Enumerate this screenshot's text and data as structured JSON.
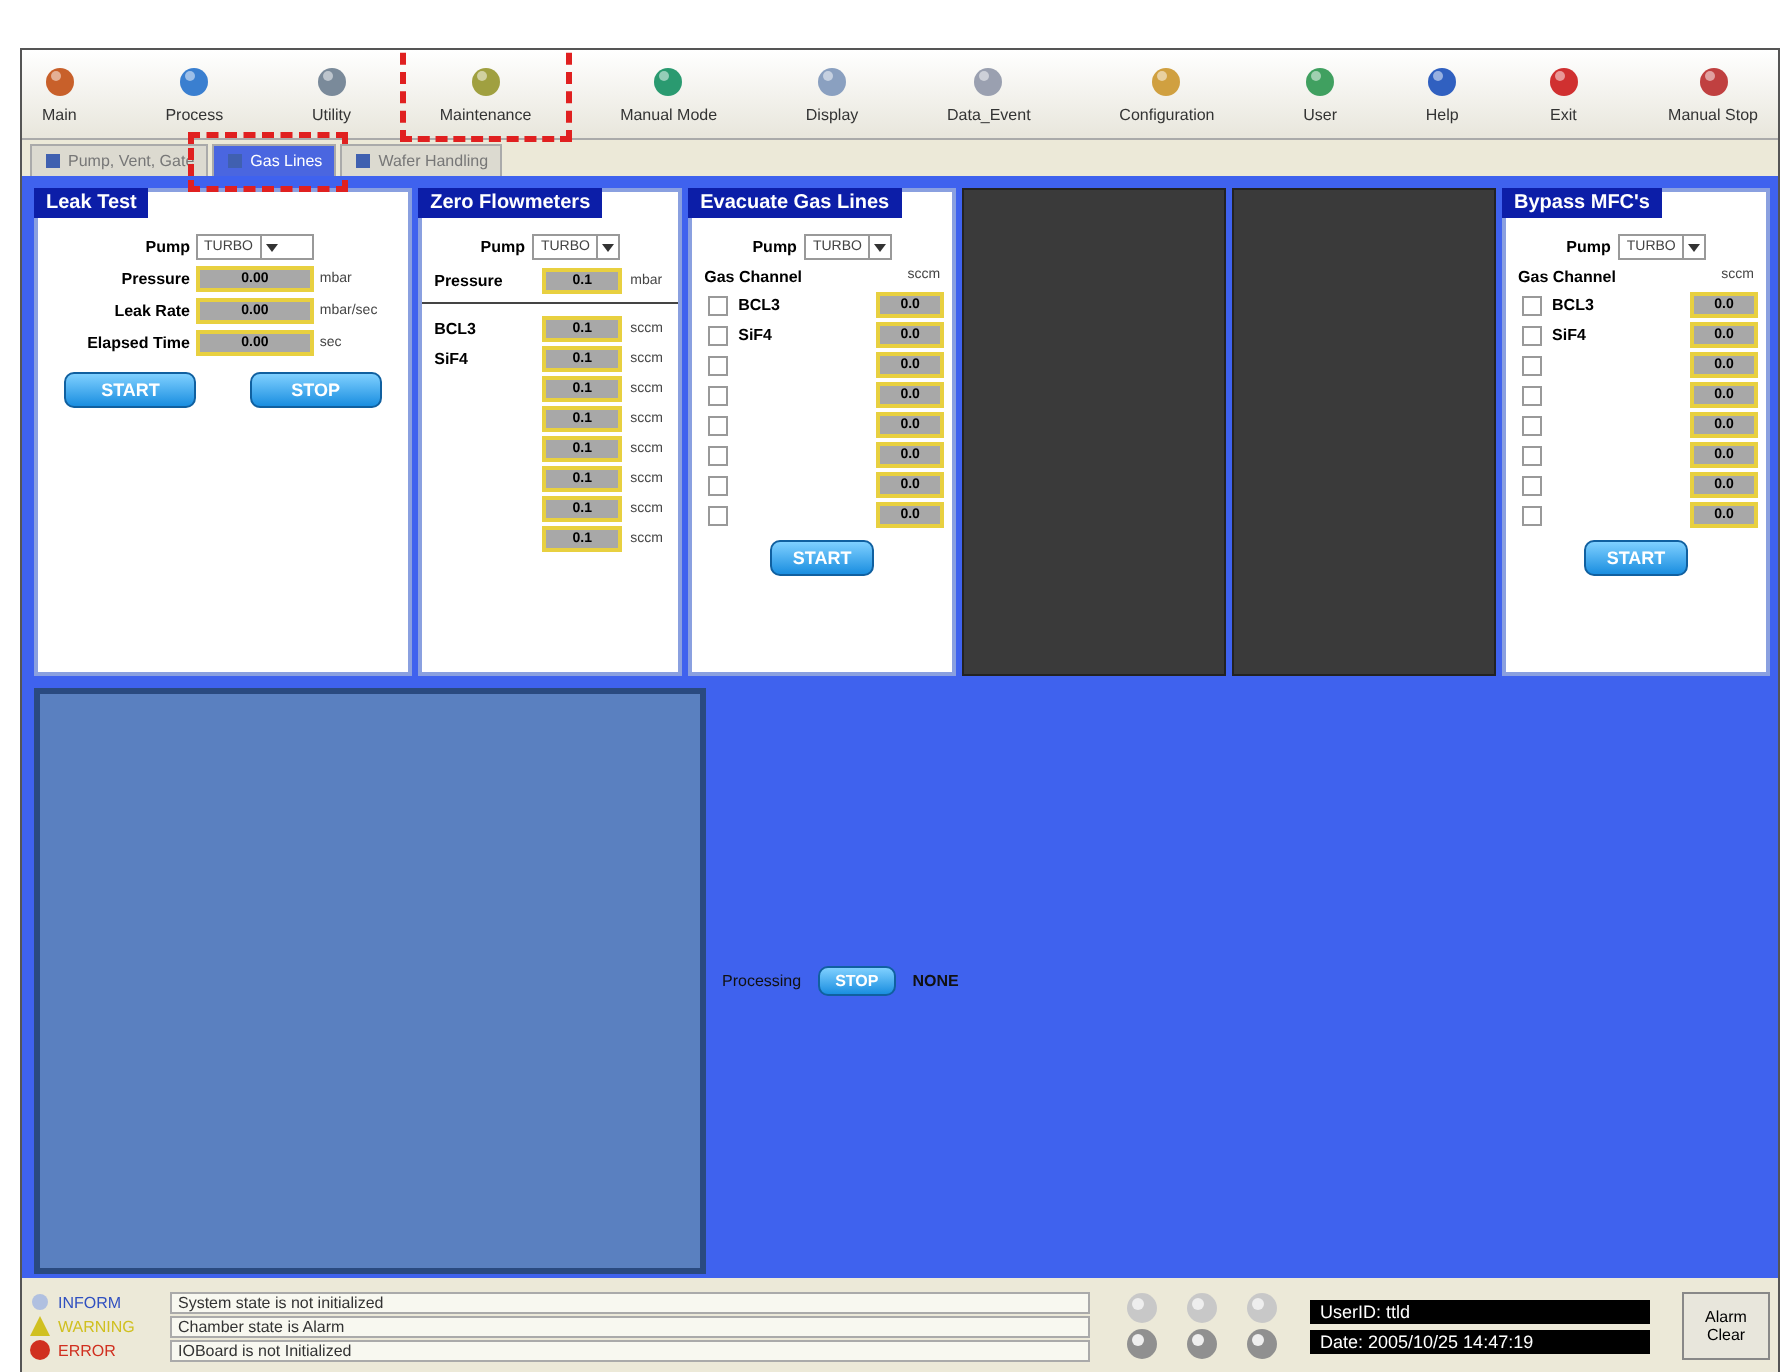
{
  "toolbar": [
    {
      "label": "Main",
      "highlighted": false
    },
    {
      "label": "Process",
      "highlighted": false
    },
    {
      "label": "Utility",
      "highlighted": false
    },
    {
      "label": "Maintenance",
      "highlighted": true
    },
    {
      "label": "Manual Mode",
      "highlighted": false
    },
    {
      "label": "Display",
      "highlighted": false
    },
    {
      "label": "Data_Event",
      "highlighted": false
    },
    {
      "label": "Configuration",
      "highlighted": false
    },
    {
      "label": "User",
      "highlighted": false
    },
    {
      "label": "Help",
      "highlighted": false
    },
    {
      "label": "Exit",
      "highlighted": false
    },
    {
      "label": "Manual Stop",
      "highlighted": false
    }
  ],
  "tabs": [
    {
      "label": "Pump, Vent, Gate",
      "selected": false,
      "highlighted": false
    },
    {
      "label": "Gas Lines",
      "selected": true,
      "highlighted": true
    },
    {
      "label": "Wafer Handling",
      "selected": false,
      "highlighted": false
    }
  ],
  "leak_test": {
    "title": "Leak Test",
    "pump_label": "Pump",
    "pump": "TURBO",
    "readings": [
      {
        "label": "Pressure",
        "value": "0.00",
        "unit": "mbar"
      },
      {
        "label": "Leak Rate",
        "value": "0.00",
        "unit": "mbar/sec"
      },
      {
        "label": "Elapsed Time",
        "value": "0.00",
        "unit": "sec"
      }
    ],
    "buttons": [
      "START",
      "STOP"
    ]
  },
  "zero_flowmeters": {
    "title": "Zero Flowmeters",
    "pump_label": "Pump",
    "pump": "TURBO",
    "pressure": {
      "label": "Pressure",
      "value": "0.1",
      "unit": "mbar"
    },
    "channels": [
      {
        "name": "BCL3",
        "value": "0.1",
        "unit": "sccm"
      },
      {
        "name": "SiF4",
        "value": "0.1",
        "unit": "sccm"
      },
      {
        "value": "0.1",
        "unit": "sccm"
      },
      {
        "value": "0.1",
        "unit": "sccm"
      },
      {
        "value": "0.1",
        "unit": "sccm"
      },
      {
        "value": "0.1",
        "unit": "sccm"
      },
      {
        "value": "0.1",
        "unit": "sccm"
      },
      {
        "value": "0.1",
        "unit": "sccm"
      }
    ]
  },
  "evacuate": {
    "title": "Evacuate Gas Lines",
    "pump_label": "Pump",
    "pump": "TURBO",
    "channel_header": "Gas Channel",
    "unit_header": "sccm",
    "button": "START",
    "channels": [
      {
        "name": "BCL3",
        "checked": false,
        "value": "0.0"
      },
      {
        "name": "SiF4",
        "checked": false,
        "value": "0.0"
      },
      {
        "checked": false,
        "value": "0.0"
      },
      {
        "checked": false,
        "value": "0.0"
      },
      {
        "checked": false,
        "value": "0.0"
      },
      {
        "checked": false,
        "value": "0.0"
      },
      {
        "checked": false,
        "value": "0.0"
      },
      {
        "checked": false,
        "value": "0.0"
      }
    ]
  },
  "bypass": {
    "title": "Bypass MFC's",
    "pump_label": "Pump",
    "pump": "TURBO",
    "channel_header": "Gas Channel",
    "unit_header": "sccm",
    "button": "START",
    "channels": [
      {
        "name": "BCL3",
        "checked": false,
        "value": "0.0"
      },
      {
        "name": "SiF4",
        "checked": false,
        "value": "0.0"
      },
      {
        "checked": false,
        "value": "0.0"
      },
      {
        "checked": false,
        "value": "0.0"
      },
      {
        "checked": false,
        "value": "0.0"
      },
      {
        "checked": false,
        "value": "0.0"
      },
      {
        "checked": false,
        "value": "0.0"
      },
      {
        "checked": false,
        "value": "0.0"
      }
    ]
  },
  "processing": {
    "label": "Processing",
    "button": "STOP",
    "state": "NONE"
  },
  "messages": [
    {
      "kind": "inform",
      "severity": "INFORM",
      "text": "System state is not initialized"
    },
    {
      "kind": "warning",
      "severity": "WARNING",
      "text": "Chamber state is Alarm"
    },
    {
      "kind": "error",
      "severity": "ERROR",
      "text": "IOBoard is not Initialized"
    }
  ],
  "user_id": "UserID: ttld",
  "date": "Date: 2005/10/25 14:47:19",
  "alarm_button": "Alarm Clear"
}
